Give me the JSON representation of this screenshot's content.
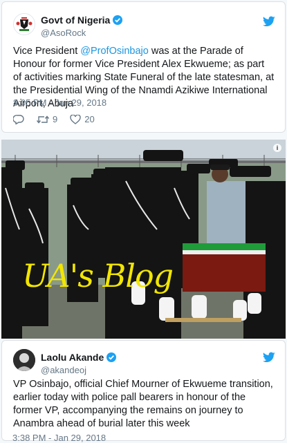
{
  "tweet1": {
    "name": "Govt of Nigeria",
    "handle": "@AsoRock",
    "text_before": "Vice President ",
    "mention": "@ProfOsinbajo",
    "text_after": "  was at the Parade of Honour for former Vice President Alex Ekwueme; as part of activities marking State Funeral of the late statesman, at the Presidential Wing of the Nnamdi Azikiwe International Airport, Abuja",
    "timestamp": "8:05 PM - Jan 29, 2018",
    "retweets": "9",
    "likes": "20"
  },
  "photo": {
    "info_symbol": "i",
    "watermark": "UA's Blog"
  },
  "tweet2": {
    "name": "Laolu Akande",
    "handle": "@akandeoj",
    "text": "VP Osinbajo, official Chief Mourner of Ekwueme transition, earlier today with police pall bearers in honour of the former VP, accompanying the remains on journey to Anambra ahead of burial later this week",
    "timestamp": "3:38 PM - Jan 29, 2018"
  },
  "colors": {
    "twitter_blue": "#1da1f2",
    "mention": "#1b95e0",
    "watermark": "#f2e600"
  },
  "icons": [
    "nigeria-coat-of-arms-avatar",
    "verified-badge-icon",
    "twitter-bird-icon",
    "reply-icon",
    "retweet-icon",
    "heart-icon",
    "info-icon"
  ]
}
